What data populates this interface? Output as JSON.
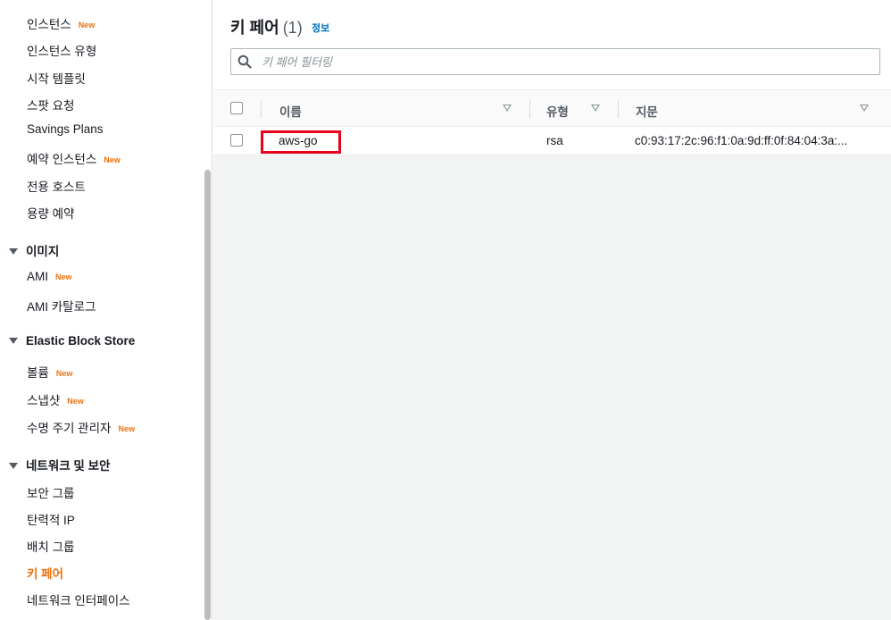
{
  "sidebar": {
    "items_top": [
      {
        "label": "인스턴스",
        "badge": "New"
      },
      {
        "label": "인스턴스 유형",
        "badge": ""
      },
      {
        "label": "시작 템플릿",
        "badge": ""
      },
      {
        "label": "스팟 요청",
        "badge": ""
      },
      {
        "label": "Savings Plans",
        "badge": ""
      },
      {
        "label": "예약 인스턴스",
        "badge": "New"
      },
      {
        "label": "전용 호스트",
        "badge": ""
      },
      {
        "label": "용량 예약",
        "badge": ""
      }
    ],
    "section_images": {
      "title": "이미지",
      "items": [
        {
          "label": "AMI",
          "badge": "New"
        },
        {
          "label": "AMI 카탈로그",
          "badge": ""
        }
      ]
    },
    "section_ebs": {
      "title": "Elastic Block Store",
      "items": [
        {
          "label": "볼륨",
          "badge": "New"
        },
        {
          "label": "스냅샷",
          "badge": "New"
        },
        {
          "label": "수명 주기 관리자",
          "badge": "New"
        }
      ]
    },
    "section_network": {
      "title": "네트워크 및 보안",
      "items": [
        {
          "label": "보안 그룹",
          "badge": ""
        },
        {
          "label": "탄력적 IP",
          "badge": ""
        },
        {
          "label": "배치 그룹",
          "badge": ""
        },
        {
          "label": "키 페어",
          "badge": ""
        },
        {
          "label": "네트워크 인터페이스",
          "badge": ""
        }
      ]
    }
  },
  "main": {
    "title": "키 페어",
    "count": "(1)",
    "info_link": "정보",
    "search_placeholder": "키 페어 필터링",
    "search_value": "",
    "columns": {
      "name": "이름",
      "type": "유형",
      "fingerprint": "지문"
    },
    "rows": [
      {
        "name": "aws-go",
        "type": "rsa",
        "fingerprint": "c0:93:17:2c:96:f1:0a:9d:ff:0f:84:04:3a:..."
      }
    ]
  },
  "colors": {
    "accent": "#ec7211",
    "link": "#0073bb",
    "highlight_box": "#e8001c"
  }
}
